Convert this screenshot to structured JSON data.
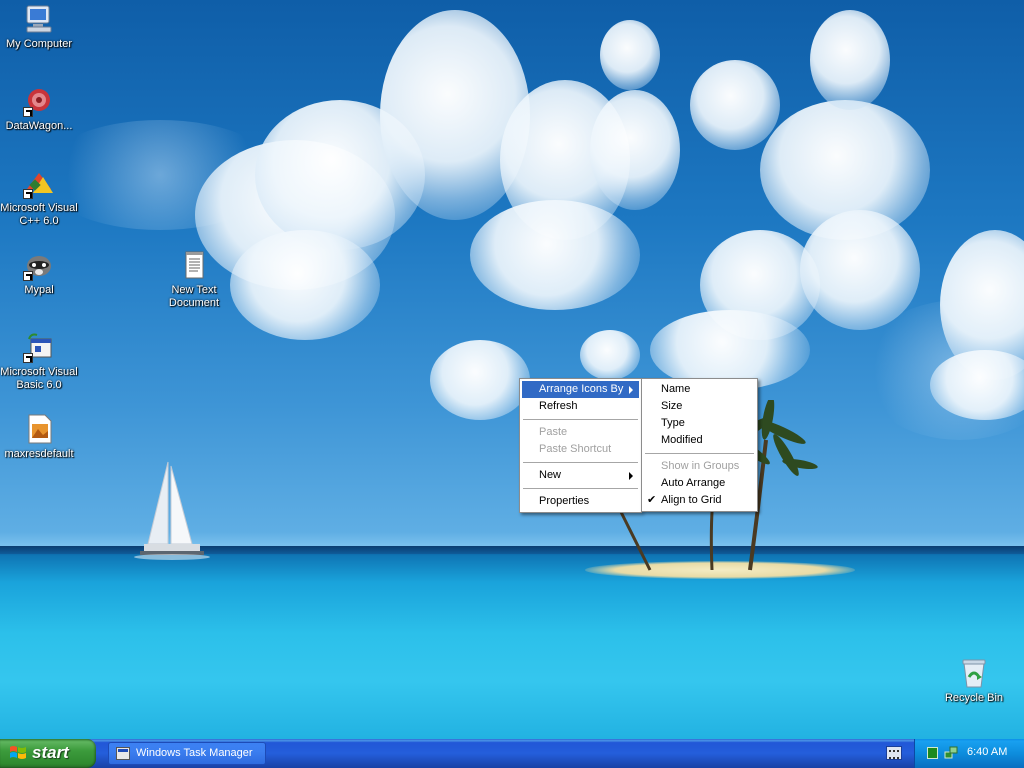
{
  "desktop": {
    "icons": [
      {
        "label": "My Computer",
        "icon": "computer-icon"
      },
      {
        "label": "DataWagon...",
        "icon": "datawagon-icon"
      },
      {
        "label": "Microsoft Visual C++ 6.0",
        "icon": "visual-cpp-icon"
      },
      {
        "label": "Mypal",
        "icon": "mypal-raccoon-icon"
      },
      {
        "label": "Microsoft Visual Basic 6.0",
        "icon": "visual-basic-icon"
      },
      {
        "label": "maxresdefault",
        "icon": "image-file-icon"
      },
      {
        "label": "New Text Document",
        "icon": "text-document-icon"
      },
      {
        "label": "Recycle Bin",
        "icon": "recycle-bin-icon"
      }
    ]
  },
  "context_menu": {
    "arrange_icons_by": "Arrange Icons By",
    "refresh": "Refresh",
    "paste": "Paste",
    "paste_shortcut": "Paste Shortcut",
    "new": "New",
    "properties": "Properties"
  },
  "submenu": {
    "name": "Name",
    "size": "Size",
    "type": "Type",
    "modified": "Modified",
    "show_in_groups": "Show in Groups",
    "auto_arrange": "Auto Arrange",
    "align_to_grid": "Align to Grid",
    "check_mark": "✔"
  },
  "taskbar": {
    "start_label": "start",
    "task_button": "Windows Task Manager",
    "clock": "6:40 AM"
  },
  "colors": {
    "menu_highlight": "#316ac5",
    "taskbar_blue": "#245edb",
    "start_green": "#3c9b3c"
  }
}
